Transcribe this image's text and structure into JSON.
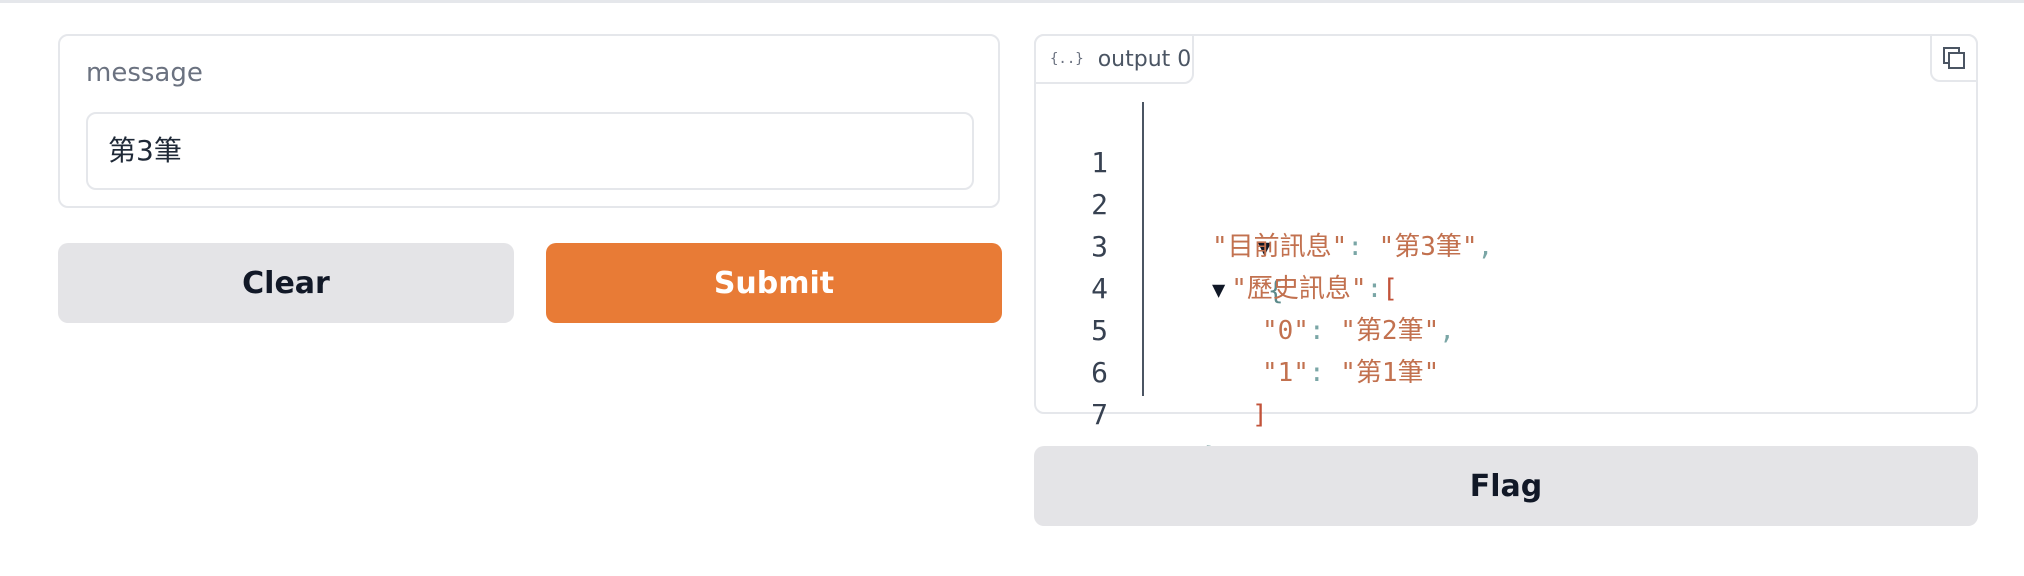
{
  "input": {
    "label": "message",
    "value": "第3筆"
  },
  "buttons": {
    "clear": "Clear",
    "submit": "Submit",
    "flag": "Flag"
  },
  "output": {
    "tab_label": "output 0",
    "tab_icon": "{..}",
    "json_lines": [
      {
        "n": "1",
        "tri": "▼",
        "brace": "{"
      },
      {
        "n": "2",
        "key": "\"目前訊息\"",
        "colon": ": ",
        "str": "\"第3筆\"",
        "comma": ","
      },
      {
        "n": "3",
        "tri": "▼",
        "key": "\"歷史訊息\"",
        "colon": ":",
        "bracket": "["
      },
      {
        "n": "4",
        "key": "\"0\"",
        "colon": ": ",
        "str": "\"第2筆\"",
        "comma": ","
      },
      {
        "n": "5",
        "key": "\"1\"",
        "colon": ": ",
        "str": "\"第1筆\""
      },
      {
        "n": "6",
        "bracket": "]"
      },
      {
        "n": "7",
        "brace": "}"
      }
    ]
  },
  "colors": {
    "submit_bg": "#e87b36",
    "secondary_bg": "#e4e4e7"
  }
}
